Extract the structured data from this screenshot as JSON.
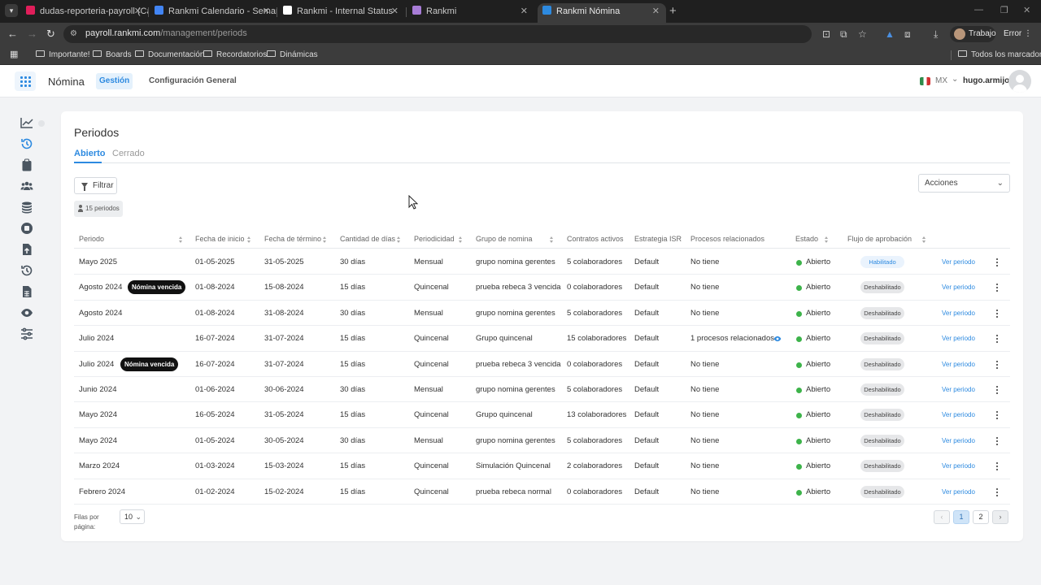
{
  "browser": {
    "tabs": [
      {
        "label": "dudas-reporteria-payroll (Cana",
        "color": "#e01e5a",
        "active": false
      },
      {
        "label": "Rankmi Calendario - Semana d",
        "color": "#4285f4",
        "active": false
      },
      {
        "label": "Rankmi - Internal Status",
        "color": "#ffffff",
        "active": false
      },
      {
        "label": "Rankmi",
        "color": "#a77cd6",
        "active": false
      },
      {
        "label": "Rankmi Nómina",
        "color": "#2d8ae0",
        "active": true
      }
    ],
    "url_host": "payroll.rankmi.com",
    "url_path": "/management/periods",
    "profile_label": "Trabajo",
    "error_label": "Error",
    "bookmarks": [
      "Importante!",
      "Boards",
      "Documentación",
      "Recordatorios",
      "Dinámicas"
    ],
    "all_bookmarks": "Todos los marcadores"
  },
  "header": {
    "app_name": "Nómina",
    "nav_active": "Gestión",
    "nav_config": "Configuración General",
    "country": "MX",
    "username": "hugo.armijo"
  },
  "sidebar": {
    "icons": [
      "chart-line-icon",
      "history-icon",
      "clipboard-icon",
      "users-icon",
      "coins-icon",
      "stop-icon",
      "upload-file-icon",
      "history-icon",
      "spreadsheet-icon",
      "eye-icon",
      "sliders-icon"
    ],
    "active_index": 1
  },
  "page": {
    "title": "Periodos",
    "tabs": [
      "Abierto",
      "Cerrado"
    ],
    "filter_label": "Filtrar",
    "count_label": "15 periodos",
    "actions_label": "Acciones"
  },
  "table": {
    "headers": [
      "Periodo",
      "Fecha de inicio",
      "Fecha de término",
      "Cantidad de días",
      "Periodicidad",
      "Grupo de nomina",
      "Contratos activos",
      "Estrategia ISR",
      "Procesos relacionados",
      "Estado",
      "Flujo de aprobación"
    ],
    "overdue_label": "Nómina vencida",
    "view_label": "Ver periodo",
    "rows": [
      {
        "periodo": "Mayo 2025",
        "overdue": false,
        "inicio": "01-05-2025",
        "termino": "31-05-2025",
        "dias": "30 días",
        "periodicidad": "Mensual",
        "grupo": "grupo nomina gerentes",
        "contratos": "5 colaboradores",
        "isr": "Default",
        "procesos": "No tiene",
        "estado": "Abierto",
        "flujo": "Habilitado",
        "flujo_on": true
      },
      {
        "periodo": "Agosto 2024",
        "overdue": true,
        "inicio": "01-08-2024",
        "termino": "15-08-2024",
        "dias": "15 días",
        "periodicidad": "Quincenal",
        "grupo": "prueba rebeca 3 vencida",
        "contratos": "0 colaboradores",
        "isr": "Default",
        "procesos": "No tiene",
        "estado": "Abierto",
        "flujo": "Deshabilitado",
        "flujo_on": false
      },
      {
        "periodo": "Agosto 2024",
        "overdue": false,
        "inicio": "01-08-2024",
        "termino": "31-08-2024",
        "dias": "30 días",
        "periodicidad": "Mensual",
        "grupo": "grupo nomina gerentes",
        "contratos": "5 colaboradores",
        "isr": "Default",
        "procesos": "No tiene",
        "estado": "Abierto",
        "flujo": "Deshabilitado",
        "flujo_on": false
      },
      {
        "periodo": "Julio 2024",
        "overdue": false,
        "inicio": "16-07-2024",
        "termino": "31-07-2024",
        "dias": "15 días",
        "periodicidad": "Quincenal",
        "grupo": "Grupo quincenal",
        "contratos": "15 colaboradores",
        "isr": "Default",
        "procesos": "1 procesos relacionados",
        "procesos_eye": true,
        "estado": "Abierto",
        "flujo": "Deshabilitado",
        "flujo_on": false
      },
      {
        "periodo": "Julio 2024",
        "overdue": true,
        "inicio": "16-07-2024",
        "termino": "31-07-2024",
        "dias": "15 días",
        "periodicidad": "Quincenal",
        "grupo": "prueba rebeca 3 vencida",
        "contratos": "0 colaboradores",
        "isr": "Default",
        "procesos": "No tiene",
        "estado": "Abierto",
        "flujo": "Deshabilitado",
        "flujo_on": false
      },
      {
        "periodo": "Junio 2024",
        "overdue": false,
        "inicio": "01-06-2024",
        "termino": "30-06-2024",
        "dias": "30 días",
        "periodicidad": "Mensual",
        "grupo": "grupo nomina gerentes",
        "contratos": "5 colaboradores",
        "isr": "Default",
        "procesos": "No tiene",
        "estado": "Abierto",
        "flujo": "Deshabilitado",
        "flujo_on": false
      },
      {
        "periodo": "Mayo 2024",
        "overdue": false,
        "inicio": "16-05-2024",
        "termino": "31-05-2024",
        "dias": "15 días",
        "periodicidad": "Quincenal",
        "grupo": "Grupo quincenal",
        "contratos": "13 colaboradores",
        "isr": "Default",
        "procesos": "No tiene",
        "estado": "Abierto",
        "flujo": "Deshabilitado",
        "flujo_on": false
      },
      {
        "periodo": "Mayo 2024",
        "overdue": false,
        "inicio": "01-05-2024",
        "termino": "30-05-2024",
        "dias": "30 días",
        "periodicidad": "Mensual",
        "grupo": "grupo nomina gerentes",
        "contratos": "5 colaboradores",
        "isr": "Default",
        "procesos": "No tiene",
        "estado": "Abierto",
        "flujo": "Deshabilitado",
        "flujo_on": false
      },
      {
        "periodo": "Marzo 2024",
        "overdue": false,
        "inicio": "01-03-2024",
        "termino": "15-03-2024",
        "dias": "15 días",
        "periodicidad": "Quincenal",
        "grupo": "Simulación Quincenal",
        "contratos": "2 colaboradores",
        "isr": "Default",
        "procesos": "No tiene",
        "estado": "Abierto",
        "flujo": "Deshabilitado",
        "flujo_on": false
      },
      {
        "periodo": "Febrero 2024",
        "overdue": false,
        "inicio": "01-02-2024",
        "termino": "15-02-2024",
        "dias": "15 días",
        "periodicidad": "Quincenal",
        "grupo": "prueba rebeca normal",
        "contratos": "0 colaboradores",
        "isr": "Default",
        "procesos": "No tiene",
        "estado": "Abierto",
        "flujo": "Deshabilitado",
        "flujo_on": false
      }
    ]
  },
  "footer": {
    "rows_label": "Filas por página:",
    "rows_value": "10",
    "pages": [
      "1",
      "2"
    ],
    "current_page": "1"
  },
  "colors": {
    "accent": "#2d8ae0",
    "status_open": "#3db34a",
    "overdue_badge": "#111111"
  }
}
